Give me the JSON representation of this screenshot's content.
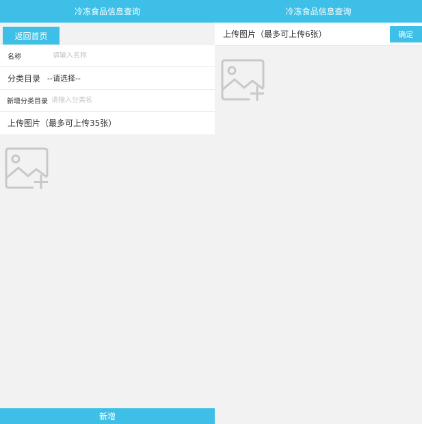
{
  "left": {
    "title": "冷冻食品信息查询",
    "back_label": "返回首页",
    "name_label": "名称",
    "name_placeholder": "请输入名称",
    "category_label": "分类目录",
    "category_value": "--请选择--",
    "new_category_label": "新增分类目录",
    "new_category_placeholder": "请输入分类名",
    "upload_label": "上传图片（最多可上传35张）",
    "add_button_label": "新增",
    "add_image_icon": "add-image-icon"
  },
  "right": {
    "title": "冷冻食品信息查询",
    "upload_label": "上传图片（最多可上传6张）",
    "confirm_label": "确定",
    "add_image_icon": "add-image-icon"
  },
  "colors": {
    "accent": "#3ebfe7",
    "background": "#f2f2f2",
    "icon_gray": "#c8c8c8"
  }
}
